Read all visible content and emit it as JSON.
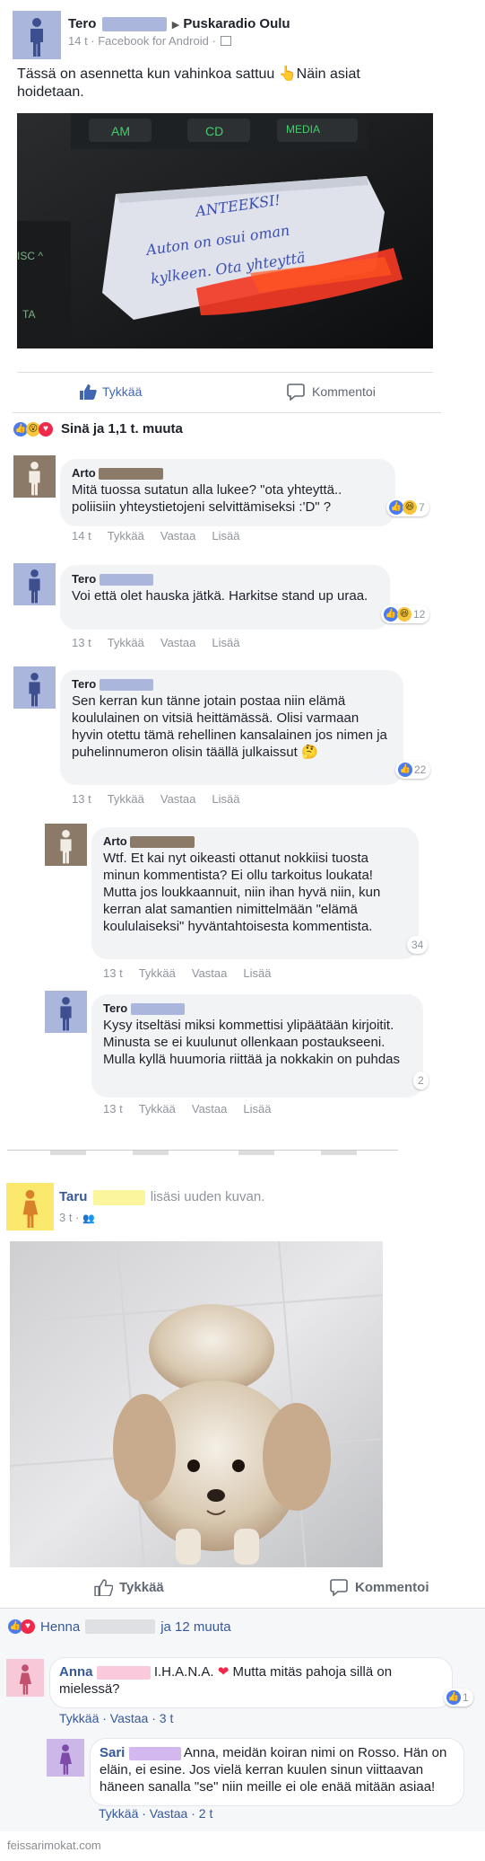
{
  "post1": {
    "author_first": "Tero",
    "page_name": "Puskaradio Oulu",
    "time": "14 t · Facebook for Android ·",
    "text": "Tässä on asennetta kun vahinkoa sattuu 👆Näin asiat hoidetaan.",
    "photo": {
      "button_labels": [
        "AM",
        "CD",
        "MEDIA"
      ],
      "note_text": "ANTEEKSI! Auton on osui oman kylkeen. Ota yhteyttä"
    },
    "like_label": "Tykkää",
    "comment_label": "Kommentoi",
    "reactions_summary": "Sinä ja 1,1 t. muuta",
    "comments": [
      {
        "author": "Arto",
        "text": "Mitä tuossa sutatun alla lukee? \"ota yhteyttä.. poliisiin yhteystietojeni selvittämiseksi :'D\" ?",
        "reactions": "7",
        "time": "14 t",
        "like": "Tykkää",
        "reply": "Vastaa",
        "more": "Lisää"
      },
      {
        "author": "Tero",
        "text": "Voi että olet hauska jätkä. Harkitse stand up uraa.",
        "reactions": "12",
        "time": "13 t",
        "like": "Tykkää",
        "reply": "Vastaa",
        "more": "Lisää"
      },
      {
        "author": "Tero",
        "text": "Sen kerran kun tänne jotain postaa niin elämä koululainen on vitsiä heittämässä. Olisi varmaan hyvin otettu tämä rehellinen kansalainen jos nimen ja puhelinnumeron olisin täällä julkaissut 🤔",
        "reactions": "22",
        "time": "13 t",
        "like": "Tykkää",
        "reply": "Vastaa",
        "more": "Lisää"
      },
      {
        "author": "Arto",
        "text": "Wtf. Et kai nyt oikeasti ottanut nokkiisi tuosta minun kommentista? Ei ollu tarkoitus loukata! Mutta jos loukkaannuit, niin ihan hyvä niin, kun kerran alat samantien nimittelmään \"elämä koululaiseksi\" hyväntahtoisesta kommentista.",
        "reactions": "34",
        "time": "13 t",
        "like": "Tykkää",
        "reply": "Vastaa",
        "more": "Lisää"
      },
      {
        "author": "Tero",
        "text": "Kysy itseltäsi miksi kommettisi ylipäätään kirjoitit. Minusta se ei kuulunut ollenkaan postaukseeni. Mulla kyllä huumoria riittää ja nokkakin on puhdas",
        "reactions": "2",
        "time": "13 t",
        "like": "Tykkää",
        "reply": "Vastaa",
        "more": "Lisää"
      }
    ]
  },
  "post2": {
    "author_first": "Taru",
    "action_text": "lisäsi uuden kuvan.",
    "time": "3 t ·",
    "like_label": "Tykkää",
    "comment_label": "Kommentoi",
    "reactions_name": "Henna",
    "reactions_rest": "ja 12 muuta",
    "comments": [
      {
        "author": "Anna",
        "text_a": "I.H.A.N.A.",
        "text_b": "Mutta mitäs pahoja sillä on mielessä?",
        "reactions": "1",
        "actions": "Tykkää · Vastaa · 3 t"
      },
      {
        "author": "Sari",
        "text_a": "Anna, meidän koiran nimi on Rosso. Hän on eläin, ei esine. Jos vielä kerran kuulen sinun viittaavan häneen sanalla \"se\" niin meille ei ole enää mitään asiaa!",
        "actions": "Tykkää · Vastaa · 2 t"
      }
    ]
  },
  "watermark": "feissarimokat.com",
  "colors": {
    "accent": "#4267b2",
    "avatar_blue": "#aab6dc",
    "avatar_brown": "#8c7a68",
    "avatar_yellow": "#fbe96e",
    "avatar_pink": "#f7c8d8",
    "avatar_purple": "#cdb6e8",
    "heart": "#f0284a"
  }
}
